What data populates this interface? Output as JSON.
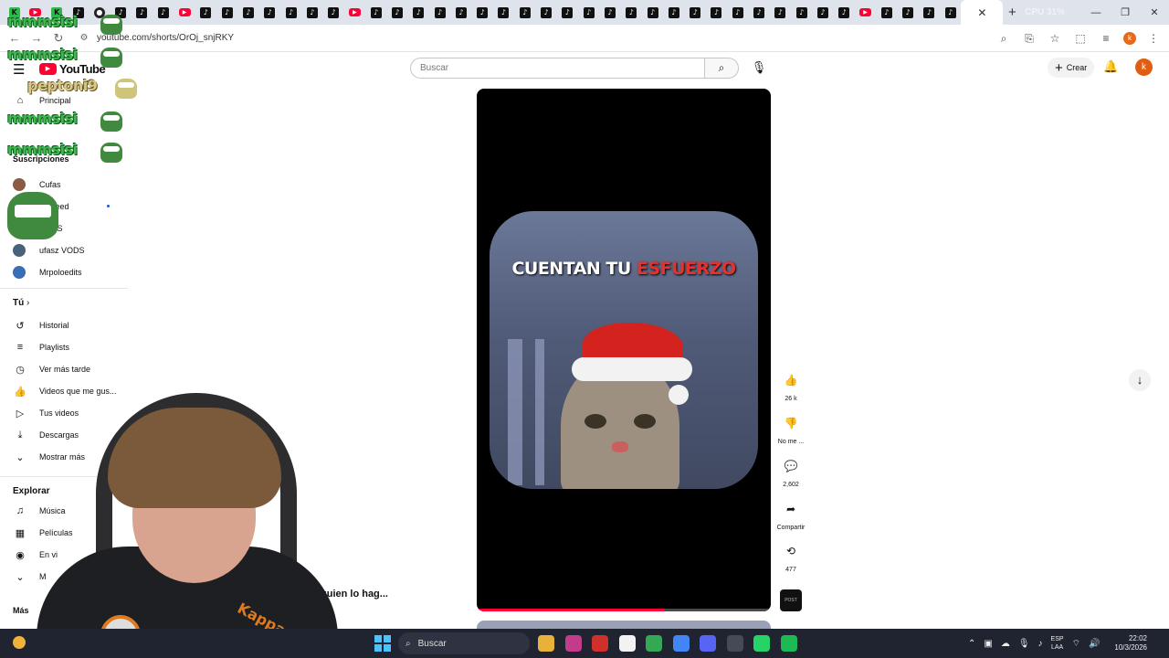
{
  "browser": {
    "tab_icons": [
      "k",
      "yt",
      "k",
      "tt",
      "circle",
      "tt",
      "tt",
      "tt",
      "yt",
      "tt",
      "tt",
      "tt",
      "tt",
      "tt",
      "tt",
      "tt",
      "yt",
      "tt",
      "tt",
      "tt",
      "tt",
      "tt",
      "tt",
      "tt",
      "tt",
      "tt",
      "tt",
      "tt",
      "tt",
      "tt",
      "tt",
      "tt",
      "tt",
      "tt",
      "tt",
      "tt",
      "tt",
      "tt",
      "tt",
      "tt",
      "yt",
      "tt",
      "tt",
      "tt",
      "tt"
    ],
    "active_tab_close": "✕",
    "new_tab": "+",
    "stats_text": "CPU 31%",
    "url": "youtube.com/shorts/OrOj_snjRKY",
    "profile_initial": "k"
  },
  "youtube": {
    "logo_text": "YouTube",
    "search_placeholder": "Buscar",
    "create_label": "Crear",
    "avatar_initial": "k",
    "brand_color": "#ff0033"
  },
  "sidebar": {
    "items_top": [
      {
        "icon": "home-icon",
        "glyph": "⌂",
        "label": "Principal"
      }
    ],
    "subscriptions_header": "Suscripciones",
    "channels": [
      {
        "label": "Cufas",
        "color": "#8a5a44"
      },
      {
        "label": "wSpeed",
        "color": "#c0392b"
      },
      {
        "label": "VODS",
        "color": "#5b6b7b"
      },
      {
        "label": "ufasz VODS",
        "color": "#48627a"
      },
      {
        "label": "Mrpoloedits",
        "color": "#3a6db5"
      }
    ],
    "you_header": "Tú",
    "you_items": [
      {
        "glyph": "↺",
        "label": "Historial"
      },
      {
        "glyph": "≡",
        "label": "Playlists"
      },
      {
        "glyph": "◷",
        "label": "Ver más tarde"
      },
      {
        "glyph": "👍",
        "label": "Videos que me gus..."
      },
      {
        "glyph": "▷",
        "label": "Tus videos"
      },
      {
        "glyph": "⤓",
        "label": "Descargas"
      },
      {
        "glyph": "⌄",
        "label": "Mostrar más"
      }
    ],
    "explore_header": "Explorar",
    "explore_items": [
      {
        "glyph": "♫",
        "label": "Música"
      },
      {
        "glyph": "▦",
        "label": "Películas"
      },
      {
        "glyph": "◉",
        "label": "En vi"
      },
      {
        "glyph": "⌄",
        "label": "M"
      }
    ],
    "more_header": "Más"
  },
  "chat_overlay": [
    {
      "text": "mmmsisi",
      "style": "green"
    },
    {
      "text": "mmmsisi",
      "style": "green"
    },
    {
      "text": "peptoni9",
      "style": "tan"
    },
    {
      "text": "mmmsisi",
      "style": "green"
    },
    {
      "text": "mmmsisi",
      "style": "green"
    }
  ],
  "short": {
    "caption_main": "CUENTAN TU ",
    "caption_accent": "ESFUERZO",
    "accent_color": "#e5322d",
    "progress": 0.64
  },
  "actions": {
    "like_count": "26 k",
    "dislike_label": "No me ...",
    "comment_count": "2,602",
    "share_label": "Compartir",
    "remix_count": "477",
    "audio_thumb_text": "POST"
  },
  "title_text": "quien lo hag...",
  "webcam": {
    "brand": "Kappa"
  },
  "taskbar": {
    "search_label": "Buscar",
    "apps": [
      {
        "name": "explorer-app",
        "color": "#e8b23a"
      },
      {
        "name": "office-app",
        "color": "#c33c8b"
      },
      {
        "name": "wps-app",
        "color": "#d0302b"
      },
      {
        "name": "store-app",
        "color": "#f2f2f2"
      },
      {
        "name": "chrome-app",
        "color": "#34a853"
      },
      {
        "name": "chrome-profile-app",
        "color": "#4285f4"
      },
      {
        "name": "discord-app",
        "color": "#5865f2"
      },
      {
        "name": "obs-app",
        "color": "#444a56"
      },
      {
        "name": "whatsapp-app",
        "color": "#25d366"
      },
      {
        "name": "spotify-app",
        "color": "#1db954"
      }
    ],
    "lang_line1": "ESP",
    "lang_line2": "LAA",
    "time": "22:02",
    "date": "10/3/2026"
  }
}
